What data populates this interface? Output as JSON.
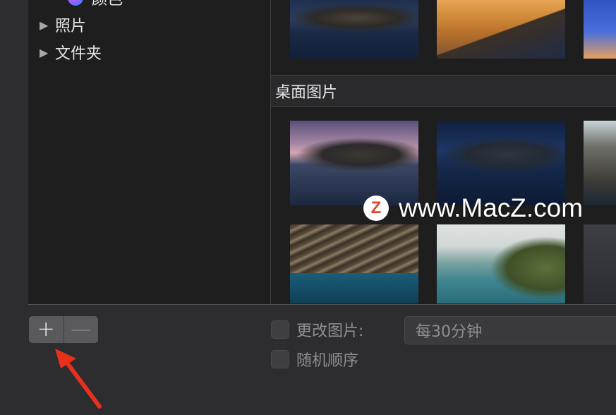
{
  "sidebar": {
    "items": [
      {
        "label": "颜色",
        "icon": "colors-icon"
      },
      {
        "label": "照片",
        "icon": "disclosure-triangle-icon"
      },
      {
        "label": "文件夹",
        "icon": "disclosure-triangle-icon"
      }
    ]
  },
  "browser": {
    "section_title": "桌面图片"
  },
  "watermark": {
    "logo_letter": "Z",
    "text": "www.MacZ.com"
  },
  "controls": {
    "add_label": "+",
    "remove_label": "—",
    "change_picture_label": "更改图片:",
    "interval_value": "每30分钟",
    "random_order_label": "随机顺序"
  },
  "colors": {
    "accent_arrow": "#e8301c",
    "background": "#2d2d2f"
  }
}
